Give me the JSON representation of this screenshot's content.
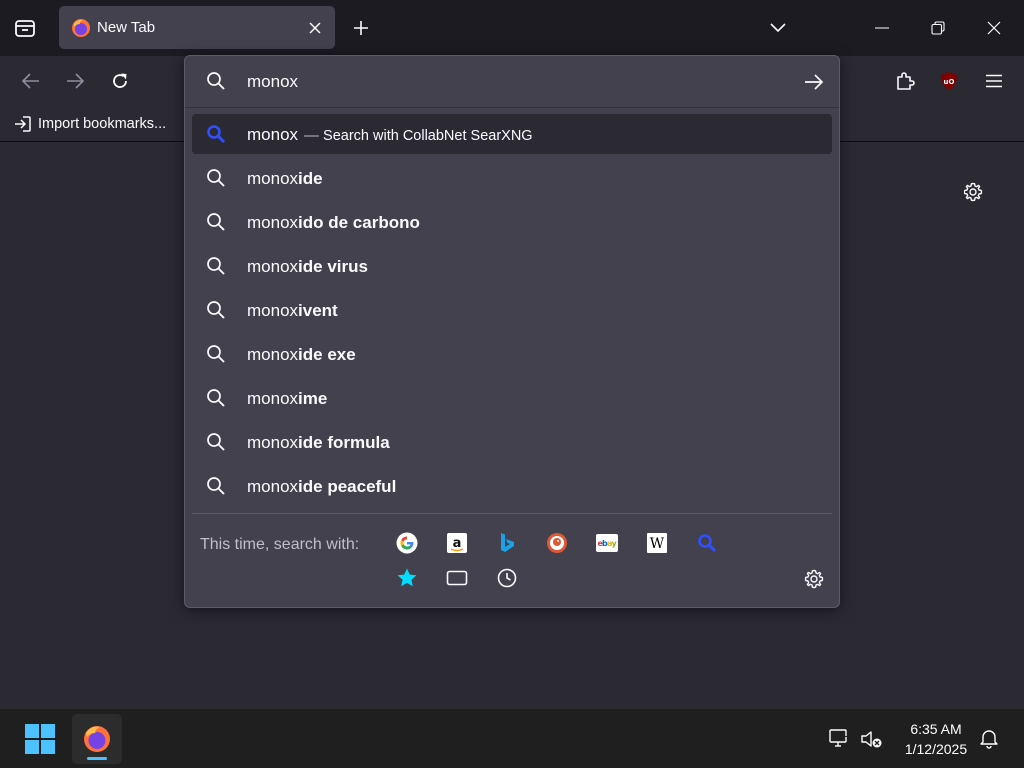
{
  "tab": {
    "title": "New Tab"
  },
  "bookmarks": {
    "import_label": "Import bookmarks..."
  },
  "urlbar": {
    "value": "monox"
  },
  "results": [
    {
      "typed": "monox",
      "completion": "",
      "action": "Search with CollabNet SearXNG",
      "dash": "—",
      "selected": true
    },
    {
      "typed": "monox",
      "completion": "ide"
    },
    {
      "typed": "monox",
      "completion": "ido de carbono"
    },
    {
      "typed": "monox",
      "completion": "ide virus"
    },
    {
      "typed": "monox",
      "completion": "ivent"
    },
    {
      "typed": "monox",
      "completion": "ide exe"
    },
    {
      "typed": "monox",
      "completion": "ime"
    },
    {
      "typed": "monox",
      "completion": "ide formula"
    },
    {
      "typed": "monox",
      "completion": "ide peaceful"
    }
  ],
  "oneoff": {
    "label": "This time, search with:",
    "engines": [
      "google-icon",
      "amazon-icon",
      "bing-icon",
      "duckduckgo-icon",
      "ebay-icon",
      "wikipedia-icon",
      "searxng-icon"
    ],
    "modes": [
      "bookmarks-star-icon",
      "tabs-icon",
      "history-clock-icon"
    ]
  },
  "taskbar": {
    "time": "6:35 AM",
    "date": "1/12/2025"
  },
  "colors": {
    "accent_blue": "#4cc2ff",
    "searx_blue": "#3050ff",
    "bookmark_star": "#00ddff"
  }
}
